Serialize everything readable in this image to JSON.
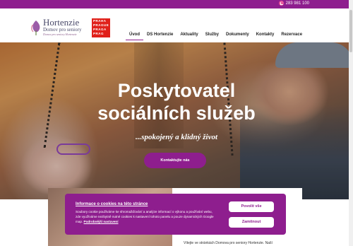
{
  "topbar": {
    "phone": "283 981 100",
    "phone_icon": "phone-icon"
  },
  "logo": {
    "title": "Hortenzie",
    "subtitle": "Domov pro seniory",
    "tagline": "Domov pro seniory Hortenzie"
  },
  "prague_logo": {
    "lines": [
      "PRAHA",
      "PRAGUE",
      "PRAGA",
      "PRAG"
    ]
  },
  "nav": {
    "items": [
      "Úvod",
      "DS Hortenzie",
      "Aktuality",
      "Služby",
      "Dokumenty",
      "Kontakty",
      "Rezervace"
    ],
    "active": "Úvod"
  },
  "hero": {
    "title_line1": "Poskytovatel",
    "title_line2": "sociálních služeb",
    "subtitle": "...spokojený a klidný život",
    "button": "Kontaktujte nás"
  },
  "lower": {
    "text": "Vítejte ve stránkách Domova pro seniory Hortenzie. Naší"
  },
  "cookie": {
    "title": "Informace o cookies na této stránce",
    "text": "Soubory cookie používáme ke shromažďování a analýze informací o výkonu a používání webu, zde využíváme nezbytně nutné cookies k nastavení tohoto panelu a pouze dynamických Google map.",
    "link": "Podrobnější nastavení",
    "accept": "Povolit vše",
    "reject": "Zamítnout"
  },
  "colors": {
    "brand": "#8e1e8e",
    "prague_red": "#e0211b"
  }
}
